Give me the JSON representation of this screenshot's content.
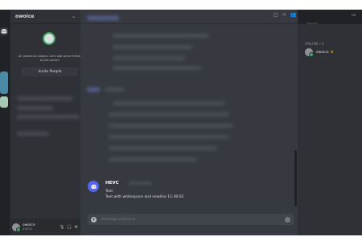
{
  "server": {
    "name": "owoice"
  },
  "invite": {
    "text": "An adventure begins. Let's add some friends to this server!",
    "button_label": "Invite People"
  },
  "user": {
    "name": "owoice",
    "tag": "#0000"
  },
  "message": {
    "author": "HEVC",
    "lines": [
      "Text",
      "Text with whitespace and newline 11:38:02"
    ]
  },
  "composer": {
    "placeholder": "Message #general"
  },
  "search": {
    "placeholder": "Search"
  },
  "members": {
    "header": "ONLINE—1",
    "list": [
      {
        "name": "owoice"
      }
    ]
  },
  "icons": {
    "home": "discord-logo-icon",
    "threads": "threads-icon",
    "notifications": "bell-icon",
    "members": "members-icon",
    "inbox": "inbox-icon",
    "mic": "microphone-icon",
    "headset": "headset-icon",
    "settings": "gear-icon",
    "add": "plus-icon"
  },
  "colors": {
    "accent": "#5865f2",
    "online": "#3ba55d",
    "crown": "#faa61a"
  }
}
